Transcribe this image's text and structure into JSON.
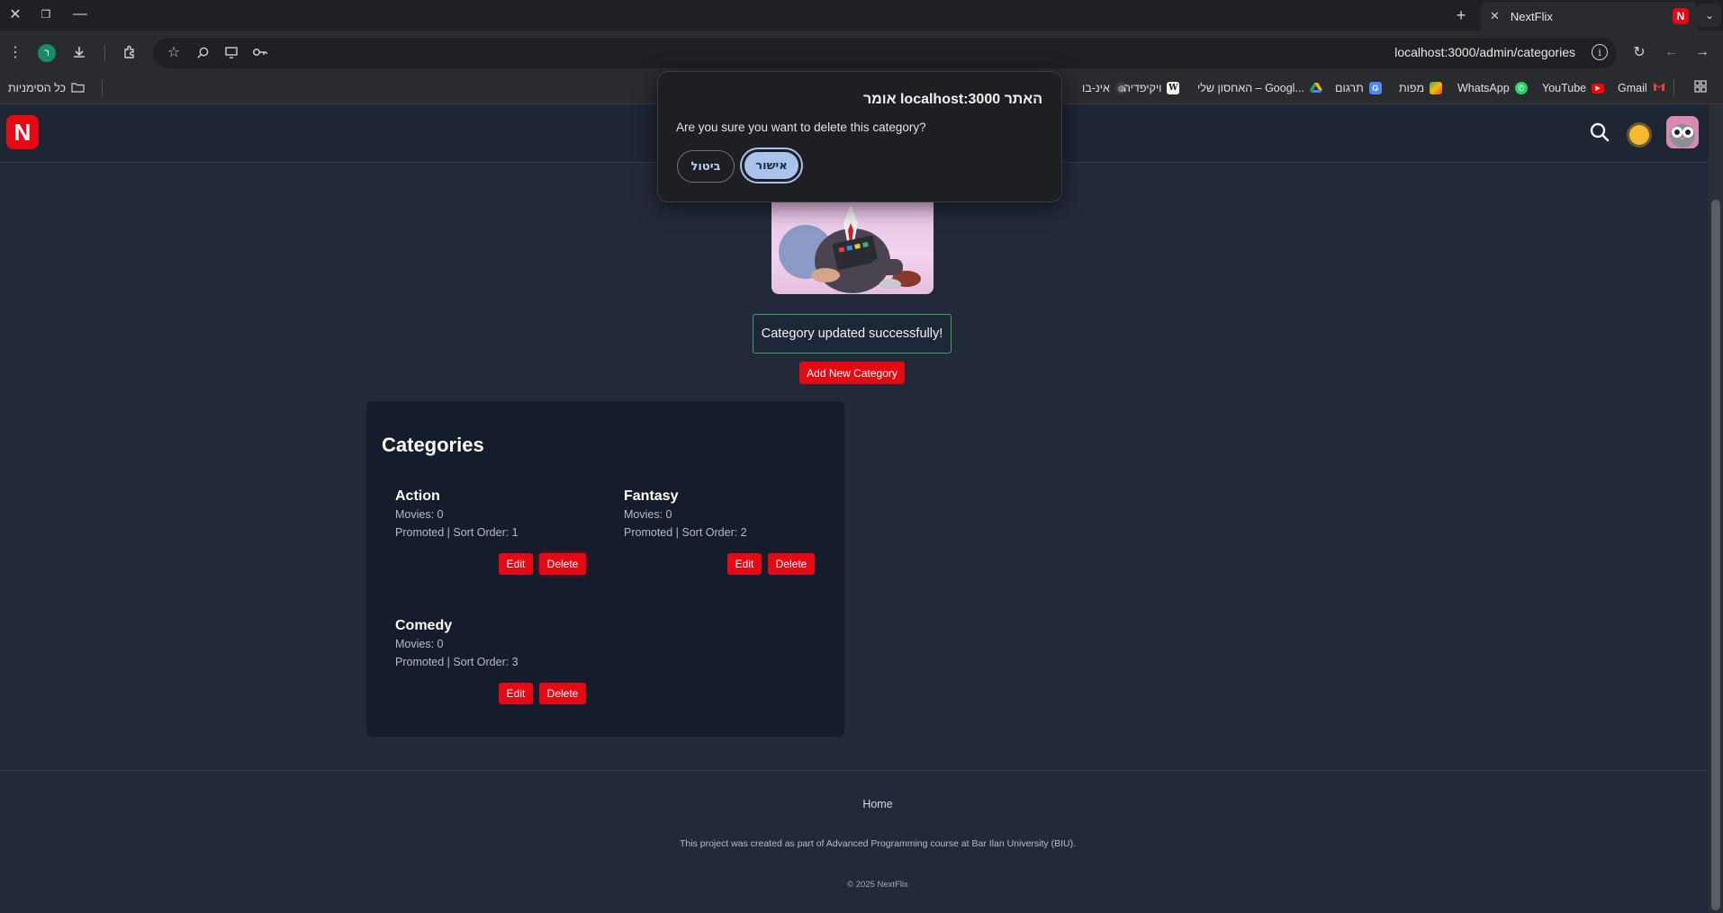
{
  "browser": {
    "tab_title": "NextFlix",
    "url": "localhost:3000/admin/categories",
    "profile_initial": "ר",
    "bookmarks": {
      "all_bookmarks": "כל הסימניות",
      "gmail": "Gmail",
      "youtube": "YouTube",
      "whatsapp": "WhatsApp",
      "maps": "מפות",
      "translate": "תרגום",
      "drive": "האחסון שלי – Googl...",
      "wikipedia": "ויקיפדיה",
      "partial": "אינ-בו"
    }
  },
  "header": {
    "logo_letter": "N"
  },
  "notice": {
    "success": "Category updated successfully!"
  },
  "actions": {
    "add_new": "Add New Category"
  },
  "categories_panel": {
    "title": "Categories",
    "items": [
      {
        "name": "Action",
        "movies": "Movies: 0",
        "meta": "Promoted | Sort Order: 1",
        "edit": "Edit",
        "delete": "Delete"
      },
      {
        "name": "Fantasy",
        "movies": "Movies: 0",
        "meta": "Promoted | Sort Order: 2",
        "edit": "Edit",
        "delete": "Delete"
      },
      {
        "name": "Comedy",
        "movies": "Movies: 0",
        "meta": "Promoted | Sort Order: 3",
        "edit": "Edit",
        "delete": "Delete"
      }
    ]
  },
  "footer": {
    "home": "Home",
    "note": "This project was created as part of Advanced Programming course at Bar Ilan University (BIU).",
    "copyright": "© 2025 NextFlix"
  },
  "dialog": {
    "title": "האתר localhost:3000 אומר",
    "message": "Are you sure you want to delete this category?",
    "ok": "אישור",
    "cancel": "ביטול"
  },
  "colors": {
    "brand_red": "#e50914",
    "page_bg": "#222a3a",
    "panel_bg": "#151c2b",
    "success_border": "#3fa55e",
    "dialog_ok": "#a9c3ec"
  }
}
